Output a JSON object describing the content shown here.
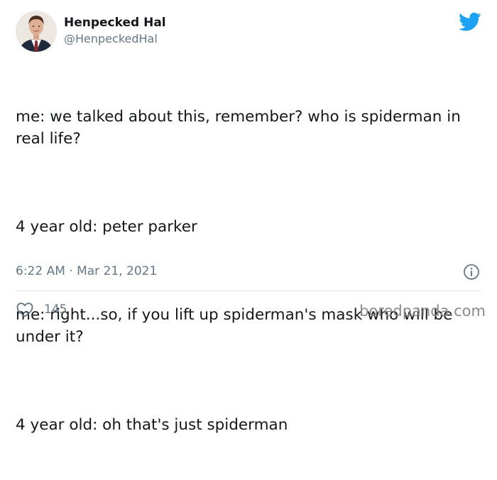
{
  "author": {
    "display_name": "Henpecked Hal",
    "handle": "@HenpeckedHal",
    "avatar": "avatar-photo"
  },
  "brand": {
    "icon": "twitter-bird-icon",
    "color": "#1da1f2"
  },
  "tweet": {
    "paragraphs": [
      "me: we talked about this, remember? who is spiderman in real life?",
      "4 year old: peter parker",
      "me: right...so, if you lift up spiderman's mask who will be under it?",
      "4 year old: oh that's just spiderman"
    ]
  },
  "meta": {
    "timestamp": "6:22 AM · Mar 21, 2021",
    "info_icon": "info-icon"
  },
  "actions": {
    "like_icon": "heart-icon",
    "like_count": "145"
  },
  "watermark": "boredpanda.com",
  "colors": {
    "text_primary": "#14171a",
    "text_secondary": "#657786",
    "divider": "#e1e8ed"
  }
}
